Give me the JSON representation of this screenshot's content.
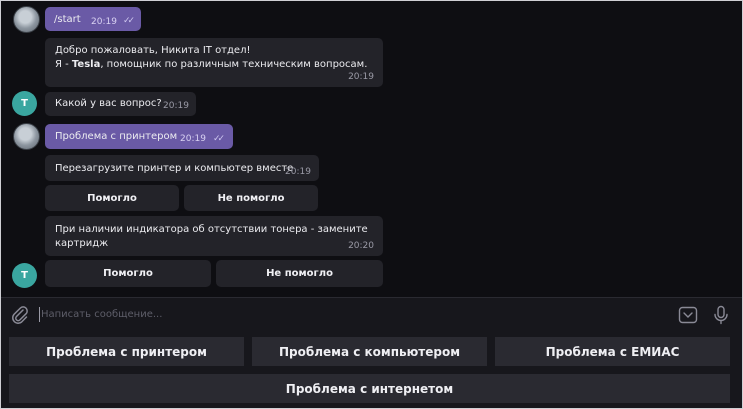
{
  "messages": {
    "start": {
      "text": "/start",
      "time": "20:19"
    },
    "welcome": {
      "line1": "Добро пожаловать, Никита IT отдел!",
      "line2_prefix": "Я - ",
      "line2_bold": "Tesla",
      "line2_suffix": ", помощник по различным техническим вопросам.",
      "time": "20:19"
    },
    "question": {
      "text": "Какой у вас вопрос?",
      "time": "20:19"
    },
    "printer": {
      "text": "Проблема с принтером",
      "time": "20:19"
    },
    "reboot": {
      "text": "Перезагрузите принтер и компьютер вместе",
      "time": "20:19"
    },
    "toner": {
      "line1": "При наличии индикатора об отсутствии тонера - замените",
      "line2": "картридж",
      "time": "20:20"
    }
  },
  "inline_buttons": {
    "row1": {
      "helped": "Помогло",
      "not_helped": "Не помогло"
    },
    "row2": {
      "helped": "Помогло",
      "not_helped": "Не помогло"
    }
  },
  "avatar_letter": "T",
  "input": {
    "placeholder": "Написать сообщение..."
  },
  "keyboard": {
    "printer": "Проблема с принтером",
    "computer": "Проблема с компьютером",
    "emias": "Проблема с ЕМИАС",
    "internet": "Проблема с интернетом"
  },
  "colors": {
    "own_bubble": "#6a5aa6",
    "bot_bubble": "#232329",
    "avatar_t": "#3aa6a0"
  }
}
